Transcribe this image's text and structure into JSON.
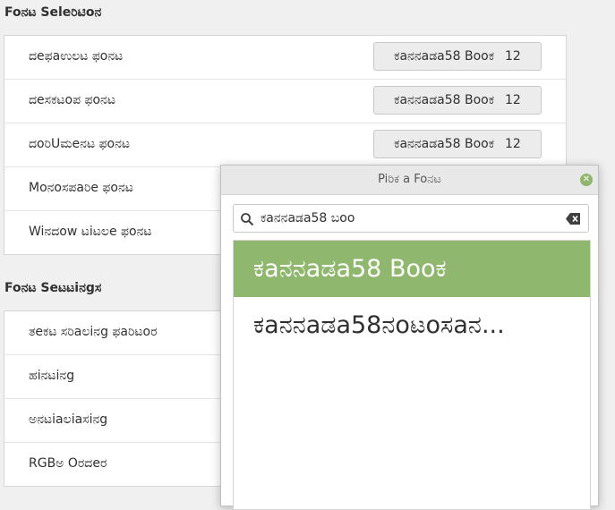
{
  "font_selection": {
    "title": "Foನಟ Seleರಿಟಿoನ",
    "rows": [
      {
        "label": "ದeಫaಉಲಟ ಫoನಟ",
        "font": "ಕaನನaಡa58 Booಕ",
        "size": "12"
      },
      {
        "label": "ದeಸಕಟoಪ ಫoನಟ",
        "font": "ಕaನನaಡa58 Booಕ",
        "size": "12"
      },
      {
        "label": "ದoರಿUಮeನಟ ಫoನಟ",
        "font": "ಕaನನaಡa58 Booಕ",
        "size": "12"
      },
      {
        "label": "Moನoಸಪaರಿe ಫoನಟ"
      },
      {
        "label": "Wiನದow ಟiಟಲe ಫoನಟ"
      }
    ]
  },
  "font_settings": {
    "title": "Foನಟ Seಟಟiನgಸ",
    "rows": [
      {
        "label": "ತeಕಟ ಸರಿaಲiನg ಫaರಿಟoರ"
      },
      {
        "label": "ಹiನಟiನg"
      },
      {
        "label": "ಅನಟiaಲiaಸiನg"
      },
      {
        "label": "RGBಅ Oರದeರ"
      }
    ]
  },
  "picker": {
    "title": "Piರಿಕ a Foನಟ",
    "search_value": "ಕaನನaಡa58 ಬoo",
    "results": [
      {
        "label": "ಕaನನaಡa58 Booಕ",
        "selected": true
      },
      {
        "label": "ಕaನನaಡa58ನoಟoಸaನ..."
      }
    ]
  },
  "colors": {
    "accent": "#8fb86e"
  }
}
